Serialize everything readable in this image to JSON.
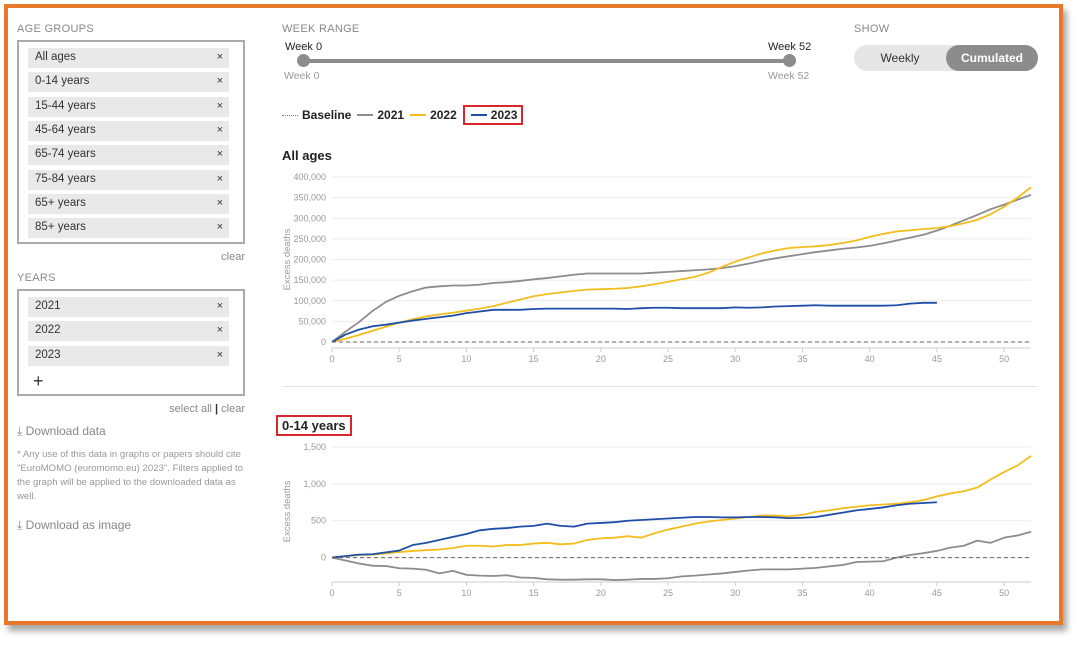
{
  "age_groups": {
    "title": "AGE GROUPS",
    "items": [
      {
        "label": "All ages"
      },
      {
        "label": "0-14 years"
      },
      {
        "label": "15-44 years"
      },
      {
        "label": "45-64 years"
      },
      {
        "label": "65-74 years"
      },
      {
        "label": "75-84 years"
      },
      {
        "label": "65+ years"
      },
      {
        "label": "85+ years"
      }
    ],
    "remove_glyph": "×",
    "clear_label": "clear"
  },
  "years": {
    "title": "YEARS",
    "items": [
      {
        "label": "2021"
      },
      {
        "label": "2022"
      },
      {
        "label": "2023"
      }
    ],
    "remove_glyph": "×",
    "add_glyph": "+",
    "select_all_label": "select all",
    "separator": "|",
    "clear_label": "clear"
  },
  "download": {
    "data_label": "Download data",
    "image_label": "Download as image",
    "icon": "download-icon",
    "icon_glyph": "⤓",
    "note": "* Any use of this data in graphs or papers should cite \"EuroMOMO (euromomo.eu) 2023\". Filters applied to the graph will be applied to the downloaded data as well."
  },
  "week_range": {
    "title": "WEEK RANGE",
    "start_label": "Week 0",
    "end_label": "Week 52",
    "start_sub": "Week 0",
    "end_sub": "Week 52",
    "min": 0,
    "max": 52,
    "start": 0,
    "end": 52
  },
  "show": {
    "title": "SHOW",
    "options": [
      "Weekly",
      "Cumulated"
    ],
    "selected": "Cumulated"
  },
  "legend": {
    "items": [
      {
        "label": "Baseline",
        "color": "#777777",
        "dash": true
      },
      {
        "label": "2021",
        "color": "#8c8c8c"
      },
      {
        "label": "2022",
        "color": "#f2bd1d"
      },
      {
        "label": "2023",
        "color": "#1f4ea8",
        "highlighted": true
      }
    ]
  },
  "colors": {
    "accent": "#e8792a",
    "highlight": "#d9262c",
    "toggle_selected": "#8c8c8c"
  },
  "chart_data": [
    {
      "type": "line",
      "title": "All ages",
      "ylabel": "Excess deaths",
      "xlim": [
        0,
        52
      ],
      "ylim": [
        0,
        400000
      ],
      "xticks": [
        0,
        5,
        10,
        15,
        20,
        25,
        30,
        35,
        40,
        45,
        50
      ],
      "yticks": [
        0,
        50000,
        100000,
        150000,
        200000,
        250000,
        300000,
        350000,
        400000
      ],
      "ytick_labels": [
        "0",
        "50,000",
        "100,000",
        "150,000",
        "200,000",
        "250,000",
        "300,000",
        "350,000",
        "400,000"
      ],
      "baseline": 0,
      "grid": true,
      "series": [
        {
          "name": "2021",
          "x": [
            0,
            1,
            2,
            3,
            4,
            5,
            6,
            7,
            8,
            9,
            10,
            11,
            12,
            13,
            14,
            15,
            16,
            17,
            18,
            19,
            20,
            21,
            22,
            23,
            24,
            25,
            26,
            27,
            28,
            29,
            30,
            31,
            32,
            33,
            34,
            35,
            36,
            37,
            38,
            39,
            40,
            41,
            42,
            43,
            44,
            45,
            46,
            47,
            48,
            49,
            50,
            51,
            52
          ],
          "values": [
            0,
            25000,
            48000,
            75000,
            97000,
            112000,
            123000,
            132000,
            135000,
            137000,
            137000,
            139000,
            143000,
            145000,
            148000,
            152000,
            155000,
            159000,
            163000,
            166000,
            166000,
            166000,
            166000,
            166000,
            168000,
            170000,
            172000,
            174000,
            176000,
            179000,
            184000,
            190000,
            197000,
            203000,
            208000,
            213000,
            218000,
            222000,
            226000,
            229000,
            233000,
            239000,
            246000,
            253000,
            260000,
            270000,
            282000,
            295000,
            308000,
            322000,
            333000,
            345000,
            357000
          ]
        },
        {
          "name": "2022",
          "x": [
            0,
            1,
            2,
            3,
            4,
            5,
            6,
            7,
            8,
            9,
            10,
            11,
            12,
            13,
            14,
            15,
            16,
            17,
            18,
            19,
            20,
            21,
            22,
            23,
            24,
            25,
            26,
            27,
            28,
            29,
            30,
            31,
            32,
            33,
            34,
            35,
            36,
            37,
            38,
            39,
            40,
            41,
            42,
            43,
            44,
            45,
            46,
            47,
            48,
            49,
            50,
            51,
            52
          ],
          "values": [
            0,
            8000,
            17000,
            27000,
            37000,
            47000,
            55000,
            62000,
            67000,
            71000,
            76000,
            81000,
            87000,
            95000,
            103000,
            111000,
            116000,
            120000,
            124000,
            127000,
            128000,
            129000,
            131000,
            135000,
            140000,
            146000,
            152000,
            158000,
            168000,
            182000,
            195000,
            205000,
            215000,
            222000,
            228000,
            230000,
            232000,
            235000,
            240000,
            246000,
            255000,
            262000,
            268000,
            271000,
            274000,
            276000,
            281000,
            288000,
            296000,
            310000,
            328000,
            350000,
            375000
          ]
        },
        {
          "name": "2023",
          "x": [
            0,
            1,
            2,
            3,
            4,
            5,
            6,
            7,
            8,
            9,
            10,
            11,
            12,
            13,
            14,
            15,
            16,
            17,
            18,
            19,
            20,
            21,
            22,
            23,
            24,
            25,
            26,
            27,
            28,
            29,
            30,
            31,
            32,
            33,
            34,
            35,
            36,
            37,
            38,
            39,
            40,
            41,
            42,
            43,
            44,
            45
          ],
          "values": [
            0,
            18000,
            30000,
            38000,
            42000,
            47000,
            52000,
            56000,
            60000,
            64000,
            70000,
            74000,
            78000,
            78000,
            78000,
            80000,
            81000,
            81000,
            81000,
            81000,
            81000,
            81000,
            80000,
            82000,
            83000,
            83000,
            82000,
            82000,
            82000,
            82000,
            84000,
            83000,
            84000,
            86000,
            87000,
            88000,
            89000,
            88000,
            88000,
            88000,
            88000,
            88000,
            89000,
            93000,
            95000,
            95000
          ]
        }
      ]
    },
    {
      "type": "line",
      "title": "0-14 years",
      "ylabel": "Excess deaths",
      "xlim": [
        0,
        52
      ],
      "ylim": [
        -250,
        1500
      ],
      "xticks": [
        0,
        5,
        10,
        15,
        20,
        25,
        30,
        35,
        40,
        45,
        50
      ],
      "yticks": [
        0,
        500,
        1000,
        1500
      ],
      "ytick_labels": [
        "0",
        "500",
        "1,000",
        "1,500"
      ],
      "baseline": 0,
      "grid": true,
      "series": [
        {
          "name": "2021",
          "x": [
            0,
            1,
            2,
            3,
            4,
            5,
            6,
            7,
            8,
            9,
            10,
            11,
            12,
            13,
            14,
            15,
            16,
            17,
            18,
            19,
            20,
            21,
            22,
            23,
            24,
            25,
            26,
            27,
            28,
            29,
            30,
            31,
            32,
            33,
            34,
            35,
            36,
            37,
            38,
            39,
            40,
            41,
            42,
            43,
            44,
            45,
            46,
            47,
            48,
            49,
            50,
            51,
            52
          ],
          "values": [
            0,
            -40,
            -80,
            -110,
            -115,
            -145,
            -150,
            -165,
            -215,
            -180,
            -235,
            -245,
            -250,
            -240,
            -270,
            -275,
            -295,
            -300,
            -300,
            -295,
            -295,
            -305,
            -300,
            -290,
            -290,
            -280,
            -255,
            -245,
            -230,
            -215,
            -195,
            -175,
            -160,
            -160,
            -160,
            -150,
            -140,
            -120,
            -100,
            -60,
            -55,
            -50,
            0,
            35,
            60,
            90,
            135,
            160,
            230,
            200,
            270,
            300,
            350
          ]
        },
        {
          "name": "2022",
          "x": [
            0,
            1,
            2,
            3,
            4,
            5,
            6,
            7,
            8,
            9,
            10,
            11,
            12,
            13,
            14,
            15,
            16,
            17,
            18,
            19,
            20,
            21,
            22,
            23,
            24,
            25,
            26,
            27,
            28,
            29,
            30,
            31,
            32,
            33,
            34,
            35,
            36,
            37,
            38,
            39,
            40,
            41,
            42,
            43,
            44,
            45,
            46,
            47,
            48,
            49,
            50,
            51,
            52
          ],
          "values": [
            0,
            20,
            35,
            40,
            55,
            75,
            90,
            100,
            110,
            130,
            160,
            160,
            150,
            170,
            170,
            190,
            200,
            180,
            190,
            240,
            260,
            270,
            290,
            270,
            330,
            380,
            420,
            460,
            490,
            510,
            530,
            550,
            570,
            570,
            560,
            580,
            620,
            640,
            670,
            690,
            710,
            720,
            730,
            750,
            780,
            830,
            870,
            900,
            950,
            1060,
            1160,
            1250,
            1380
          ]
        },
        {
          "name": "2023",
          "x": [
            0,
            1,
            2,
            3,
            4,
            5,
            6,
            7,
            8,
            9,
            10,
            11,
            12,
            13,
            14,
            15,
            16,
            17,
            18,
            19,
            20,
            21,
            22,
            23,
            24,
            25,
            26,
            27,
            28,
            29,
            30,
            31,
            32,
            33,
            34,
            35,
            36,
            37,
            38,
            39,
            40,
            41,
            42,
            43,
            44,
            45
          ],
          "values": [
            0,
            20,
            40,
            45,
            70,
            95,
            170,
            200,
            240,
            280,
            320,
            370,
            390,
            400,
            420,
            430,
            460,
            430,
            420,
            460,
            470,
            480,
            500,
            510,
            520,
            530,
            540,
            550,
            550,
            545,
            545,
            550,
            550,
            545,
            535,
            540,
            550,
            580,
            610,
            640,
            660,
            680,
            710,
            730,
            740,
            750
          ]
        }
      ]
    }
  ]
}
